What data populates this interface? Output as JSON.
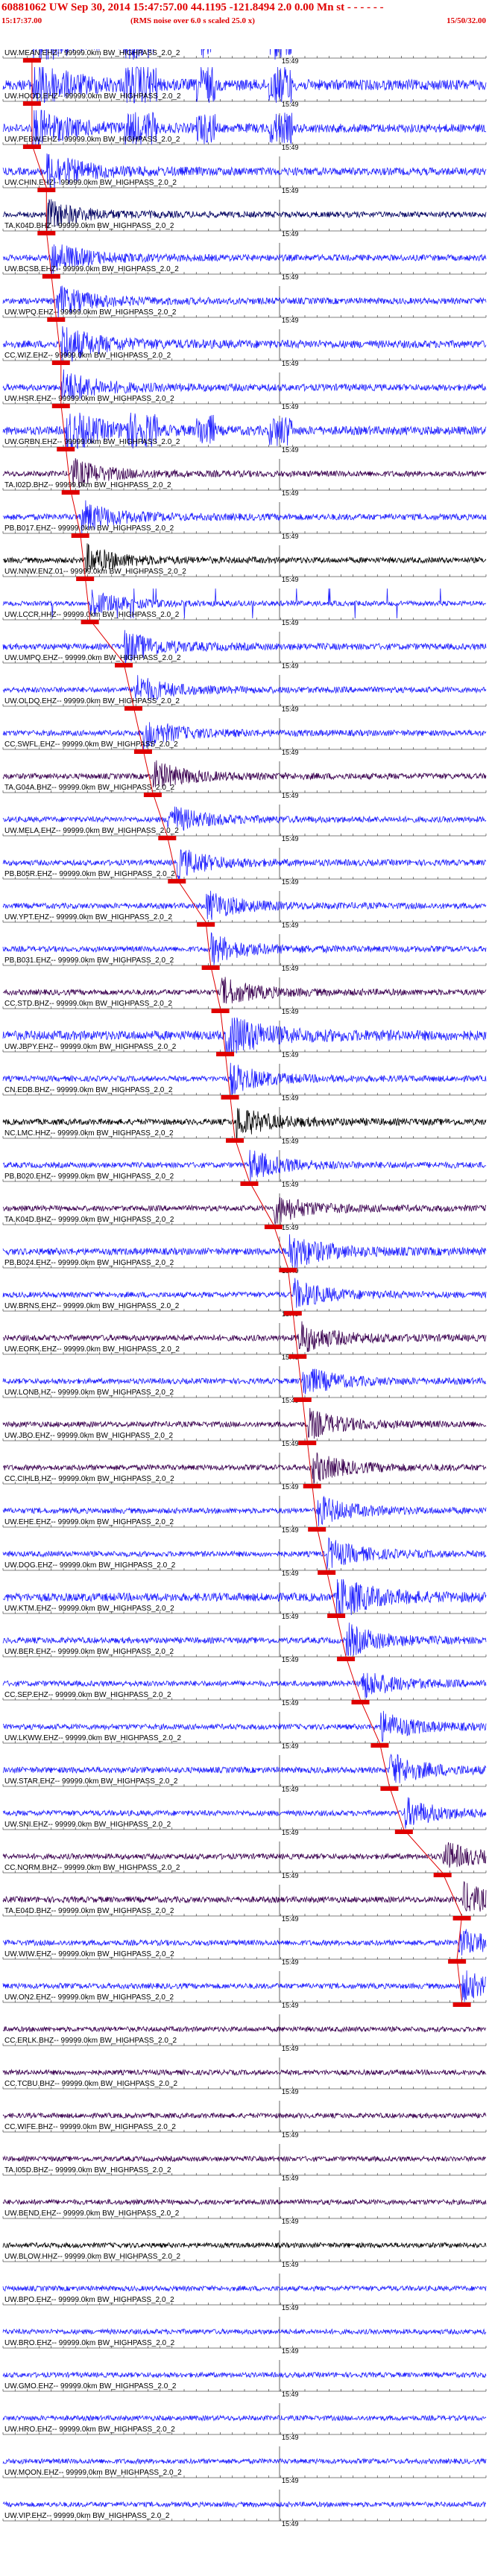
{
  "header": {
    "title": "60881062 UW Sep 30, 2014 15:47:57.00    44.1195  -121.8494  2.0 0.00 Mn st - - - - - -",
    "start_time": "15:17:37.00",
    "subtitle": "(RMS noise over 6.0 s scaled 25.0 x)",
    "end_time": "15/50/32.00"
  },
  "chart_data": {
    "type": "line",
    "description_of_axes": "stacked seismograms; x = time, each trace = one station",
    "tick_label": "15:49",
    "channel_suffix": "-- 99999.0km BW_HIGHPASS_2.0_2",
    "traces": [
      {
        "station": "UW.MEAN.EHZ",
        "color": "#2020ff",
        "amp": 0.8,
        "bursts": true,
        "pick": 0.06
      },
      {
        "station": "UW.HOOD.EHZ",
        "color": "#2020ff",
        "amp": 0.8,
        "bursts": true,
        "pick": 0.06
      },
      {
        "station": "UW.PEBW.EHZ",
        "color": "#2020ff",
        "amp": 0.6,
        "bursts": true,
        "pick": 0.06
      },
      {
        "station": "UW.CHIN.EHZ",
        "color": "#2020ff",
        "amp": 0.5,
        "pick": 0.09
      },
      {
        "station": "TA.K04D.BHZ",
        "color": "#000060",
        "amp": 0.3,
        "pick": 0.09
      },
      {
        "station": "UW.BCSB.EHZ",
        "color": "#2020ff",
        "amp": 0.35,
        "pick": 0.1
      },
      {
        "station": "UW.WPQ.EHZ",
        "color": "#2020ff",
        "amp": 0.35,
        "pick": 0.11
      },
      {
        "station": "CC.WIZ.EHZ",
        "color": "#2020ff",
        "amp": 0.5,
        "pick": 0.12
      },
      {
        "station": "UW.HSR.EHZ",
        "color": "#2020ff",
        "amp": 0.4,
        "pick": 0.12
      },
      {
        "station": "UW.GRBN.EHZ",
        "color": "#2020ff",
        "amp": 0.6,
        "bursts": true,
        "pick": 0.13
      },
      {
        "station": "TA.I02D.BHZ",
        "color": "#3a0050",
        "amp": 0.3,
        "pick": 0.14
      },
      {
        "station": "PB.B017.EHZ",
        "color": "#2020ff",
        "amp": 0.35,
        "pick": 0.16
      },
      {
        "station": "UW.NNW.ENZ.01",
        "color": "#000000",
        "amp": 0.3,
        "pick": 0.17
      },
      {
        "station": "UW.LCCR.HHZ",
        "color": "#2020ff",
        "amp": 0.2,
        "spikes": true,
        "pick": 0.18
      },
      {
        "station": "UW.UMPQ.EHZ",
        "color": "#2020ff",
        "amp": 0.35,
        "pick": 0.25
      },
      {
        "station": "UW.OLDQ.EHZ",
        "color": "#2020ff",
        "amp": 0.3,
        "pick": 0.27
      },
      {
        "station": "CC.SWFL.EHZ",
        "color": "#2020ff",
        "amp": 0.3,
        "pick": 0.29
      },
      {
        "station": "TA.G04A.BHZ",
        "color": "#3a0050",
        "amp": 0.3,
        "pick": 0.31
      },
      {
        "station": "UW.MELA.EHZ",
        "color": "#2020ff",
        "amp": 0.3,
        "pick": 0.34
      },
      {
        "station": "PB.B05R.EHZ",
        "color": "#2020ff",
        "amp": 0.3,
        "pick": 0.36
      },
      {
        "station": "UW.YPT.EHZ",
        "color": "#2020ff",
        "amp": 0.3,
        "pick": 0.42
      },
      {
        "station": "PB.B031.EHZ",
        "color": "#2020ff",
        "amp": 0.3,
        "pick": 0.43
      },
      {
        "station": "CC.STD.BHZ",
        "color": "#3a0050",
        "amp": 0.3,
        "pick": 0.45
      },
      {
        "station": "UW.JBPY.EHZ",
        "color": "#2020ff",
        "amp": 0.7,
        "pick": 0.46
      },
      {
        "station": "CN.EDB.BHZ",
        "color": "#2020ff",
        "amp": 0.3,
        "pick": 0.47
      },
      {
        "station": "NC.LMC.HHZ",
        "color": "#000000",
        "amp": 0.35,
        "pick": 0.48
      },
      {
        "station": "PB.B020.EHZ",
        "color": "#2020ff",
        "amp": 0.3,
        "pick": 0.51
      },
      {
        "station": "TA.K04D.BHZ",
        "color": "#3a0050",
        "amp": 0.3,
        "pick": 0.56
      },
      {
        "station": "PB.B024.EHZ",
        "color": "#2020ff",
        "amp": 0.45,
        "pick": 0.59
      },
      {
        "station": "UW.BRNS.EHZ",
        "color": "#2020ff",
        "amp": 0.3,
        "pick": 0.6
      },
      {
        "station": "UW.EORK.EHZ",
        "color": "#3a0050",
        "amp": 0.35,
        "pick": 0.61
      },
      {
        "station": "UW.LONB.HZ",
        "color": "#2020ff",
        "amp": 0.3,
        "pick": 0.62
      },
      {
        "station": "UW.JBO.EHZ",
        "color": "#3a0050",
        "amp": 0.3,
        "pick": 0.63
      },
      {
        "station": "CC.CIHLB.HZ",
        "color": "#3a0050",
        "amp": 0.3,
        "pick": 0.64
      },
      {
        "station": "UW.EHE.EHZ",
        "color": "#2020ff",
        "amp": 0.3,
        "pick": 0.65
      },
      {
        "station": "UW.DOG.EHZ",
        "color": "#2020ff",
        "amp": 0.3,
        "pick": 0.67
      },
      {
        "station": "UW.KTM.EHZ",
        "color": "#2020ff",
        "amp": 0.6,
        "pick": 0.69
      },
      {
        "station": "UW.BER.EHZ",
        "color": "#2020ff",
        "amp": 0.35,
        "pick": 0.71
      },
      {
        "station": "CC.SEP.EHZ",
        "color": "#2020ff",
        "amp": 0.3,
        "pick": 0.74
      },
      {
        "station": "UW.LKWW.EHZ",
        "color": "#2020ff",
        "amp": 0.3,
        "pick": 0.78
      },
      {
        "station": "UW.STAR.EHZ",
        "color": "#2020ff",
        "amp": 0.35,
        "pick": 0.8
      },
      {
        "station": "UW.SNI.EHZ",
        "color": "#2020ff",
        "amp": 0.3,
        "pick": 0.83
      },
      {
        "station": "CC.NORM.BHZ",
        "color": "#3a0050",
        "amp": 0.3,
        "pick": 0.91
      },
      {
        "station": "TA.E04D.BHZ",
        "color": "#3a0050",
        "amp": 0.35,
        "pick": 0.95
      },
      {
        "station": "UW.WIW.EHZ",
        "color": "#2020ff",
        "amp": 0.3,
        "pick": 0.94
      },
      {
        "station": "UW.ON2.EHZ",
        "color": "#2020ff",
        "amp": 0.3,
        "pick": 0.95
      },
      {
        "station": "CC.ERLK.BHZ",
        "color": "#3a0050",
        "amp": 0.25
      },
      {
        "station": "CC.TCBU.BHZ",
        "color": "#3a0050",
        "amp": 0.25
      },
      {
        "station": "CC.WIFE.BHZ",
        "color": "#3a0050",
        "amp": 0.25
      },
      {
        "station": "TA.I05D.BHZ",
        "color": "#3a0050",
        "amp": 0.25
      },
      {
        "station": "UW.BEND.EHZ",
        "color": "#3a0050",
        "amp": 0.25
      },
      {
        "station": "UW.BLOW.HHZ",
        "color": "#000000",
        "amp": 0.25
      },
      {
        "station": "UW.BPO.EHZ",
        "color": "#2020ff",
        "amp": 0.25
      },
      {
        "station": "UW.BRO.EHZ",
        "color": "#2020ff",
        "amp": 0.25
      },
      {
        "station": "UW.GMO.EHZ",
        "color": "#2020ff",
        "amp": 0.25
      },
      {
        "station": "UW.HRO.EHZ",
        "color": "#2020ff",
        "amp": 0.25
      },
      {
        "station": "UW.MOON.EHZ",
        "color": "#2020ff",
        "amp": 0.25
      },
      {
        "station": "UW.VIP.EHZ",
        "color": "#2020ff",
        "amp": 0.25
      }
    ]
  }
}
